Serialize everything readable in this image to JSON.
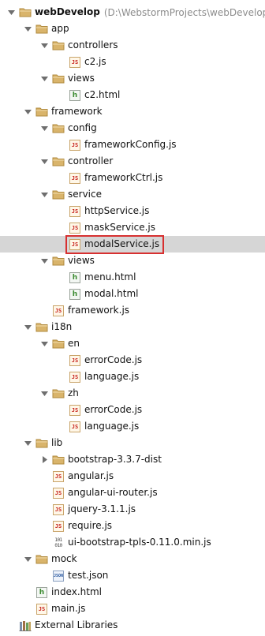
{
  "project": {
    "name": "webDevelop",
    "path": "(D:\\WebstormProjects\\webDevelop)"
  },
  "tree": [
    {
      "label": "webDevelop",
      "icon": "folder-icon",
      "arrow": "expanded",
      "bold": true
    },
    {
      "label": "app",
      "icon": "folder-icon",
      "arrow": "expanded"
    },
    {
      "label": "controllers",
      "icon": "folder-icon",
      "arrow": "expanded"
    },
    {
      "label": "c2.js",
      "icon": "js-file-icon"
    },
    {
      "label": "views",
      "icon": "folder-icon",
      "arrow": "expanded"
    },
    {
      "label": "c2.html",
      "icon": "html-file-icon"
    },
    {
      "label": "framework",
      "icon": "folder-icon",
      "arrow": "expanded"
    },
    {
      "label": "config",
      "icon": "folder-icon",
      "arrow": "expanded"
    },
    {
      "label": "frameworkConfig.js",
      "icon": "js-file-icon"
    },
    {
      "label": "controller",
      "icon": "folder-icon",
      "arrow": "expanded"
    },
    {
      "label": "frameworkCtrl.js",
      "icon": "js-file-icon"
    },
    {
      "label": "service",
      "icon": "folder-icon",
      "arrow": "expanded"
    },
    {
      "label": "httpService.js",
      "icon": "js-file-icon"
    },
    {
      "label": "maskService.js",
      "icon": "js-file-icon"
    },
    {
      "label": "modalService.js",
      "icon": "js-file-icon",
      "selected": true,
      "highlighted": true
    },
    {
      "label": "views",
      "icon": "folder-icon",
      "arrow": "expanded"
    },
    {
      "label": "menu.html",
      "icon": "html-file-icon"
    },
    {
      "label": "modal.html",
      "icon": "html-file-icon"
    },
    {
      "label": "framework.js",
      "icon": "js-file-icon"
    },
    {
      "label": "i18n",
      "icon": "folder-icon",
      "arrow": "expanded"
    },
    {
      "label": "en",
      "icon": "folder-icon",
      "arrow": "expanded"
    },
    {
      "label": "errorCode.js",
      "icon": "js-file-icon"
    },
    {
      "label": "language.js",
      "icon": "js-file-icon"
    },
    {
      "label": "zh",
      "icon": "folder-icon",
      "arrow": "expanded"
    },
    {
      "label": "errorCode.js",
      "icon": "js-file-icon"
    },
    {
      "label": "language.js",
      "icon": "js-file-icon"
    },
    {
      "label": "lib",
      "icon": "folder-icon",
      "arrow": "expanded"
    },
    {
      "label": "bootstrap-3.3.7-dist",
      "icon": "folder-icon",
      "arrow": "collapsed"
    },
    {
      "label": "angular.js",
      "icon": "js-file-icon"
    },
    {
      "label": "angular-ui-router.js",
      "icon": "js-file-icon"
    },
    {
      "label": "jquery-3.1.1.js",
      "icon": "js-file-icon"
    },
    {
      "label": "require.js",
      "icon": "js-file-icon"
    },
    {
      "label": "ui-bootstrap-tpls-0.11.0.min.js",
      "icon": "binary-file-icon"
    },
    {
      "label": "mock",
      "icon": "folder-icon",
      "arrow": "expanded"
    },
    {
      "label": "test.json",
      "icon": "json-file-icon"
    },
    {
      "label": "index.html",
      "icon": "html-file-icon"
    },
    {
      "label": "main.js",
      "icon": "js-file-icon"
    },
    {
      "label": "External Libraries",
      "icon": "libraries-icon"
    }
  ],
  "colors": {
    "folder": "#d9b46b",
    "folder_dark": "#b08a3e",
    "selection": "#d6d6d6",
    "highlight": "#d73030"
  }
}
